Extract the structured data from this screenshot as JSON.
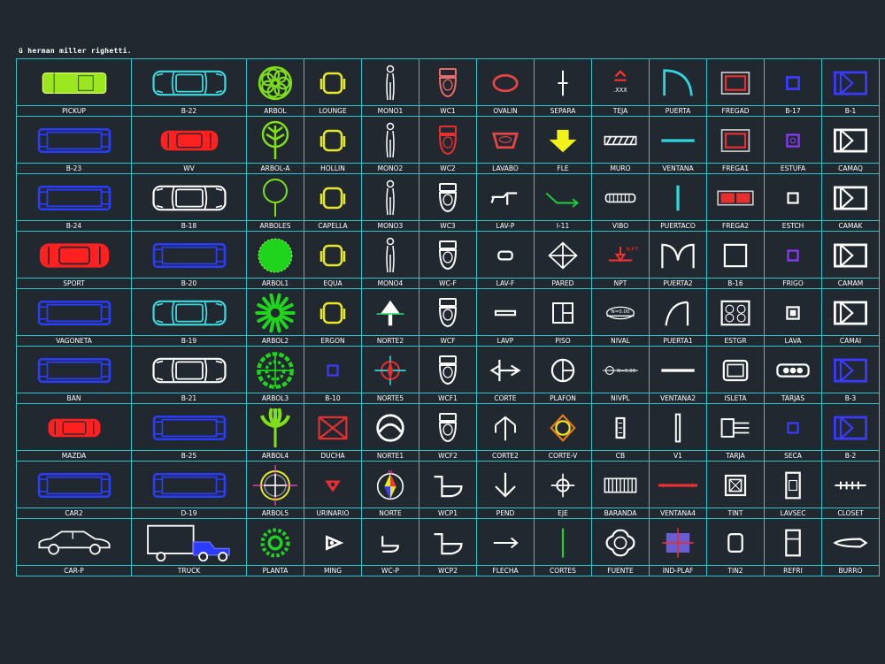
{
  "title": "ü herman miller righetti.",
  "rows": [
    [
      {
        "label": "PICKUP",
        "icon": "pickup-icon",
        "color": "#9be61e"
      },
      {
        "label": "B-22",
        "icon": "car-icon",
        "color": "#3ddbe0"
      },
      {
        "label": "ARBOL",
        "icon": "tree-icon",
        "color": "#7fe01a"
      },
      {
        "label": "LOUNGE",
        "icon": "chair-icon",
        "color": "#e8e82a"
      },
      {
        "label": "MONO1",
        "icon": "person-icon",
        "color": "#ffffff"
      },
      {
        "label": "WC1",
        "icon": "toilet-icon",
        "color": "#e86a6a"
      },
      {
        "label": "OVALIN",
        "icon": "oval-basin-icon",
        "color": "#e64545"
      },
      {
        "label": "SEPARA",
        "icon": "separator-icon",
        "color": "#ffffff"
      },
      {
        "label": "TEJA",
        "icon": "tile-icon",
        "color": "#ff3030"
      },
      {
        "label": "PUERTA",
        "icon": "door-swing-icon",
        "color": "#2fd6dc"
      },
      {
        "label": "FREGAD",
        "icon": "sink-icon",
        "color": "#e63030"
      },
      {
        "label": "B-17",
        "icon": "square-icon",
        "color": "#3b3bff"
      },
      {
        "label": "B-1",
        "icon": "bed-icon",
        "color": "#3b3bff"
      }
    ],
    [
      {
        "label": "B-23",
        "icon": "bus-icon",
        "color": "#2a3cff"
      },
      {
        "label": "WV",
        "icon": "beetle-icon",
        "color": "#ff2020"
      },
      {
        "label": "ARBOL-A",
        "icon": "tree-branch-icon",
        "color": "#7fe01a"
      },
      {
        "label": "HOLLIN",
        "icon": "chair-icon",
        "color": "#e8e82a"
      },
      {
        "label": "MONO2",
        "icon": "person-icon",
        "color": "#ffffff"
      },
      {
        "label": "WC2",
        "icon": "toilet-top-icon",
        "color": "#e63030"
      },
      {
        "label": "LAVABO",
        "icon": "basin-icon",
        "color": "#e64545"
      },
      {
        "label": "FLE",
        "icon": "arrow-down-icon",
        "color": "#f2f21a"
      },
      {
        "label": "MURO",
        "icon": "wall-hatch-icon",
        "color": "#ffffff"
      },
      {
        "label": "VENTANA",
        "icon": "window-line-icon",
        "color": "#2fd6dc"
      },
      {
        "label": "FREGA1",
        "icon": "sink-icon",
        "color": "#e63030"
      },
      {
        "label": "ESTUFA",
        "icon": "stove-icon",
        "color": "#8a3bff"
      },
      {
        "label": "CAMAQ",
        "icon": "bed-icon",
        "color": "#ffffff"
      }
    ],
    [
      {
        "label": "B-24",
        "icon": "bus-icon",
        "color": "#2a3cff"
      },
      {
        "label": "B-18",
        "icon": "car-icon",
        "color": "#ffffff"
      },
      {
        "label": "ARBOLES",
        "icon": "tree-outline-icon",
        "color": "#7fe01a"
      },
      {
        "label": "CAPELLA",
        "icon": "chair-icon",
        "color": "#e8e82a"
      },
      {
        "label": "MONO3",
        "icon": "person-icon",
        "color": "#ffffff"
      },
      {
        "label": "WC3",
        "icon": "toilet-top-icon",
        "color": "#ffffff"
      },
      {
        "label": "LAV-P",
        "icon": "faucet-icon",
        "color": "#ffffff"
      },
      {
        "label": "I-11",
        "icon": "zigzag-arrow-icon",
        "color": "#1ecf3c"
      },
      {
        "label": "VIBO",
        "icon": "vibro-icon",
        "color": "#ffffff"
      },
      {
        "label": "PUERTACO",
        "icon": "door-line-icon",
        "color": "#2fd6dc"
      },
      {
        "label": "FREGA2",
        "icon": "double-sink-icon",
        "color": "#e63030"
      },
      {
        "label": "ESTCH",
        "icon": "small-square-icon",
        "color": "#ffffff"
      },
      {
        "label": "CAMAK",
        "icon": "bed-icon",
        "color": "#ffffff"
      }
    ],
    [
      {
        "label": "SPORT",
        "icon": "sportscar-icon",
        "color": "#ff2020"
      },
      {
        "label": "B-20",
        "icon": "bus-icon",
        "color": "#2a3cff"
      },
      {
        "label": "ARBOL1",
        "icon": "tree-solid-icon",
        "color": "#20d41e"
      },
      {
        "label": "EQUA",
        "icon": "chair-icon",
        "color": "#e8e82a"
      },
      {
        "label": "MONO4",
        "icon": "person-icon",
        "color": "#ffffff"
      },
      {
        "label": "WC-F",
        "icon": "toilet-top-icon",
        "color": "#ffffff"
      },
      {
        "label": "LAV-F",
        "icon": "small-basin-icon",
        "color": "#ffffff"
      },
      {
        "label": "PARED",
        "icon": "diamond-icon",
        "color": "#ffffff"
      },
      {
        "label": "NPT",
        "icon": "level-mark-icon",
        "color": "#ff3030"
      },
      {
        "label": "PUERTA2",
        "icon": "double-door-icon",
        "color": "#ffffff"
      },
      {
        "label": "B-16",
        "icon": "square-outline-icon",
        "color": "#ffffff"
      },
      {
        "label": "FRIGO",
        "icon": "small-square-icon",
        "color": "#8a3bff"
      },
      {
        "label": "CAMAM",
        "icon": "bed-icon",
        "color": "#ffffff"
      }
    ],
    [
      {
        "label": "VAGONETA",
        "icon": "van-icon",
        "color": "#2a3cff"
      },
      {
        "label": "B-19",
        "icon": "car-icon",
        "color": "#3ddbe0"
      },
      {
        "label": "ARBOL2",
        "icon": "tree-star-icon",
        "color": "#20d41e"
      },
      {
        "label": "ERGON",
        "icon": "chair-icon",
        "color": "#e8e82a"
      },
      {
        "label": "NORTE2",
        "icon": "north-arrow-icon",
        "color": "#ffffff"
      },
      {
        "label": "WCF",
        "icon": "toilet-top-icon",
        "color": "#ffffff"
      },
      {
        "label": "LAVP",
        "icon": "flat-basin-icon",
        "color": "#ffffff"
      },
      {
        "label": "PISO",
        "icon": "floor-square-icon",
        "color": "#ffffff"
      },
      {
        "label": "NIVAL",
        "icon": "level-tag-icon",
        "color": "#ffffff"
      },
      {
        "label": "PUERTA1",
        "icon": "door-arc-icon",
        "color": "#ffffff"
      },
      {
        "label": "ESTGR",
        "icon": "stove-grill-icon",
        "color": "#ffffff"
      },
      {
        "label": "LAVA",
        "icon": "washer-icon",
        "color": "#ffffff"
      },
      {
        "label": "CAMAI",
        "icon": "bed-icon",
        "color": "#ffffff"
      }
    ],
    [
      {
        "label": "BAN",
        "icon": "bus-icon",
        "color": "#2a3cff"
      },
      {
        "label": "B-21",
        "icon": "car-icon",
        "color": "#ffffff"
      },
      {
        "label": "ARBOL3",
        "icon": "tree-leafy-icon",
        "color": "#20d41e"
      },
      {
        "label": "B-10",
        "icon": "small-square-icon",
        "color": "#3b3bff"
      },
      {
        "label": "NORTE5",
        "icon": "crosshair-icon",
        "color": "#e63030"
      },
      {
        "label": "WCF1",
        "icon": "toilet-top-icon",
        "color": "#ffffff"
      },
      {
        "label": "CORTE",
        "icon": "section-cut-icon",
        "color": "#ffffff"
      },
      {
        "label": "PLAFON",
        "icon": "ceiling-icon",
        "color": "#ffffff"
      },
      {
        "label": "NIVPL",
        "icon": "level-plan-icon",
        "color": "#ffffff"
      },
      {
        "label": "VENTANA2",
        "icon": "window-line-icon",
        "color": "#ffffff"
      },
      {
        "label": "ISLETA",
        "icon": "island-icon",
        "color": "#ffffff"
      },
      {
        "label": "TARJAS",
        "icon": "tarjas-icon",
        "color": "#ffffff"
      },
      {
        "label": "B-3",
        "icon": "bed-icon",
        "color": "#3b3bff"
      }
    ],
    [
      {
        "label": "MAZDA",
        "icon": "mazda-icon",
        "color": "#ff2020"
      },
      {
        "label": "B-25",
        "icon": "bus-icon",
        "color": "#2a3cff"
      },
      {
        "label": "ARBOL4",
        "icon": "palm-icon",
        "color": "#7fe01a"
      },
      {
        "label": "DUCHA",
        "icon": "shower-icon",
        "color": "#e63030"
      },
      {
        "label": "NORTE1",
        "icon": "north-circle-icon",
        "color": "#ffffff"
      },
      {
        "label": "WCF2",
        "icon": "toilet-top-icon",
        "color": "#ffffff"
      },
      {
        "label": "CORTE2",
        "icon": "section-arrow-icon",
        "color": "#ffffff"
      },
      {
        "label": "CORTE-V",
        "icon": "section-v-icon",
        "color": "#e8e82a"
      },
      {
        "label": "CB",
        "icon": "cb-icon",
        "color": "#ffffff"
      },
      {
        "label": "V1",
        "icon": "window-vertical-icon",
        "color": "#ffffff"
      },
      {
        "label": "TARJA",
        "icon": "tarja-icon",
        "color": "#ffffff"
      },
      {
        "label": "SECA",
        "icon": "small-square-icon",
        "color": "#3b3bff"
      },
      {
        "label": "B-2",
        "icon": "bed-icon",
        "color": "#3b3bff"
      }
    ],
    [
      {
        "label": "CAR2",
        "icon": "bus-icon",
        "color": "#2a3cff"
      },
      {
        "label": "D-19",
        "icon": "bus-icon",
        "color": "#2a3cff"
      },
      {
        "label": "ARBOL5",
        "icon": "tree-crosshair-icon",
        "color": "#e8e82a"
      },
      {
        "label": "URINARIO",
        "icon": "urinal-icon",
        "color": "#e63030"
      },
      {
        "label": "NORTE",
        "icon": "north-compass-icon",
        "color": "#ff3030"
      },
      {
        "label": "WCP1",
        "icon": "toilet-side-icon",
        "color": "#ffffff"
      },
      {
        "label": "PEND",
        "icon": "slope-arrow-icon",
        "color": "#ffffff"
      },
      {
        "label": "EJE",
        "icon": "axis-icon",
        "color": "#ffffff"
      },
      {
        "label": "BARANDA",
        "icon": "railing-icon",
        "color": "#ffffff"
      },
      {
        "label": "VENTANA4",
        "icon": "window-red-icon",
        "color": "#e63030"
      },
      {
        "label": "TINT",
        "icon": "tint-icon",
        "color": "#ffffff"
      },
      {
        "label": "LAVSEC",
        "icon": "lavsec-icon",
        "color": "#ffffff"
      },
      {
        "label": "CLOSET",
        "icon": "closet-icon",
        "color": "#ffffff"
      }
    ],
    [
      {
        "label": "CAR-P",
        "icon": "car-side-icon",
        "color": "#ffffff"
      },
      {
        "label": "TRUCK",
        "icon": "truck-icon",
        "color": "#ffffff"
      },
      {
        "label": "PLANTA",
        "icon": "plant-icon",
        "color": "#20d41e"
      },
      {
        "label": "MING",
        "icon": "ming-icon",
        "color": "#ffffff"
      },
      {
        "label": "WC-P",
        "icon": "toilet-profile-icon",
        "color": "#ffffff"
      },
      {
        "label": "WCP2",
        "icon": "toilet-side-icon",
        "color": "#ffffff"
      },
      {
        "label": "FLECHA",
        "icon": "arrow-right-icon",
        "color": "#ffffff"
      },
      {
        "label": "CORTES",
        "icon": "cut-line-icon",
        "color": "#1ecf3c"
      },
      {
        "label": "FUENTE",
        "icon": "fountain-icon",
        "color": "#ffffff"
      },
      {
        "label": "IND-PLAF",
        "icon": "ind-plaf-icon",
        "color": "#7a6aff"
      },
      {
        "label": "TIN2",
        "icon": "tin2-icon",
        "color": "#ffffff"
      },
      {
        "label": "REFRI",
        "icon": "fridge-icon",
        "color": "#ffffff"
      },
      {
        "label": "BURRO",
        "icon": "burro-icon",
        "color": "#ffffff"
      }
    ]
  ]
}
